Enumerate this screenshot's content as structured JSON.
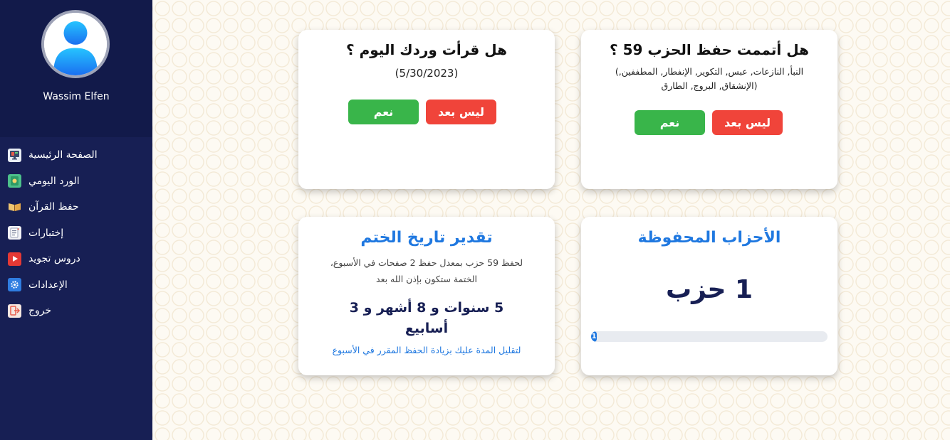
{
  "user": {
    "name": "Wassim Elfen"
  },
  "menu": [
    {
      "label": "الصفحة الرئيسية",
      "icon": "monitor-icon",
      "icon_color": "#e9eef5"
    },
    {
      "label": "الورد اليومي",
      "icon": "quran-book-icon",
      "icon_color": "#4cc08a"
    },
    {
      "label": "حفظ القرآن",
      "icon": "open-book-icon",
      "icon_color": "#f0c670"
    },
    {
      "label": "إختبارات",
      "icon": "exam-paper-icon",
      "icon_color": "#f2f2f6"
    },
    {
      "label": "دروس تجويد",
      "icon": "video-play-icon",
      "icon_color": "#e53935"
    },
    {
      "label": "الإعدادات",
      "icon": "gear-icon",
      "icon_color": "#2f7de1"
    },
    {
      "label": "خروج",
      "icon": "logout-icon",
      "icon_color": "#f5e6e0"
    }
  ],
  "daily_card": {
    "title": "هل قرأت وردك اليوم ؟",
    "date": "(5/30/2023)",
    "yes_label": "نعم",
    "no_label": "ليس بعد"
  },
  "hizb_card": {
    "title": "هل أتممت حفظ الحزب 59 ؟",
    "surahs_line1": "النبأ, النازعات, عبس, التكوير, الإنفطار, المطففين,)",
    "surahs_line2": "(الإنشقاق, البروج, الطارق",
    "yes_label": "نعم",
    "no_label": "ليس بعد"
  },
  "estimate_card": {
    "title": "تقدير تاريخ الختم",
    "desc_line1": "لحفظ 59 حزب بمعدل حفظ 2 صفحات في الأسبوع،",
    "desc_line2": "الختمة ستكون بإذن الله بعد",
    "duration_line1": "5 سنوات و 8 أشهر و 3",
    "duration_line2": "أسابيع",
    "hint": "لتقليل المدة عليك بزيادة الحفظ المقرر في الأسبوع"
  },
  "memorized_card": {
    "title": "الأحزاب المحفوظة",
    "count_text": "1 حزب",
    "progress_label": "1",
    "progress_fraction": 0.017
  },
  "colors": {
    "sidebar": "#171f54",
    "accent_blue": "#1f78e0",
    "yes_green": "#39b54a",
    "no_red": "#f0443a"
  }
}
